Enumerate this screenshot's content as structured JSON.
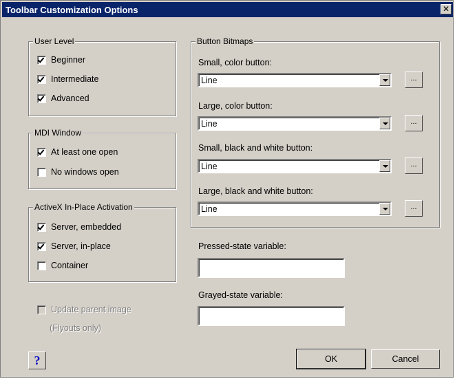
{
  "window": {
    "title": "Toolbar Customization Options",
    "close_glyph": "✕"
  },
  "user_level": {
    "legend": "User Level",
    "items": [
      {
        "label": "Beginner",
        "checked": true
      },
      {
        "label": "Intermediate",
        "checked": true
      },
      {
        "label": "Advanced",
        "checked": true
      }
    ]
  },
  "mdi_window": {
    "legend": "MDI Window",
    "items": [
      {
        "label": "At least one open",
        "checked": true
      },
      {
        "label": "No windows open",
        "checked": false
      }
    ]
  },
  "activex": {
    "legend": "ActiveX In-Place Activation",
    "items": [
      {
        "label": "Server, embedded",
        "checked": true
      },
      {
        "label": "Server, in-place",
        "checked": true
      },
      {
        "label": "Container",
        "checked": false
      }
    ]
  },
  "update_parent": {
    "label": "Update parent image",
    "note": "(Flyouts only)",
    "checked": false,
    "enabled": false
  },
  "button_bitmaps": {
    "legend": "Button Bitmaps",
    "rows": [
      {
        "label": "Small, color button:",
        "value": "Line",
        "browse": "..."
      },
      {
        "label": "Large, color button:",
        "value": "Line",
        "browse": "..."
      },
      {
        "label": "Small, black and white button:",
        "value": "Line",
        "browse": "..."
      },
      {
        "label": "Large, black and white button:",
        "value": "Line",
        "browse": "..."
      }
    ]
  },
  "pressed_state": {
    "label": "Pressed-state variable:",
    "value": ""
  },
  "grayed_state": {
    "label": "Grayed-state variable:",
    "value": ""
  },
  "buttons": {
    "help": "?",
    "ok": "OK",
    "cancel": "Cancel"
  }
}
